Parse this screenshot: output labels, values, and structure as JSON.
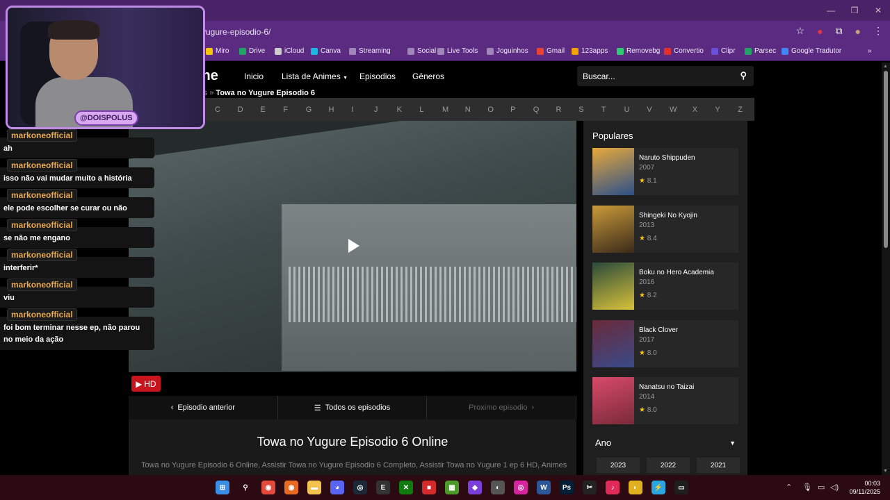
{
  "browser": {
    "url": "yugure-episodio-6/",
    "bookmarks": [
      {
        "label": "Miro",
        "color": "#f7c600"
      },
      {
        "label": "Drive",
        "color": "#1fa463"
      },
      {
        "label": "iCloud",
        "color": "#cccccc"
      },
      {
        "label": "Canva",
        "color": "#1db6e0"
      },
      {
        "label": "Streaming",
        "color": "#9e86b8"
      },
      {
        "label": "Social",
        "color": "#9e86b8"
      },
      {
        "label": "Live Tools",
        "color": "#9e86b8"
      },
      {
        "label": "Joguinhos",
        "color": "#9e86b8"
      },
      {
        "label": "Gmail",
        "color": "#ea4335"
      },
      {
        "label": "123apps",
        "color": "#f2a100"
      },
      {
        "label": "Removebg",
        "color": "#2ecc71"
      },
      {
        "label": "Convertio",
        "color": "#e5302a"
      },
      {
        "label": "Clipr",
        "color": "#6b4fd8"
      },
      {
        "label": "Parsec",
        "color": "#21a366"
      },
      {
        "label": "Google Tradutor",
        "color": "#4285f4"
      }
    ]
  },
  "site": {
    "logo_partial": "ine",
    "nav": [
      "Inicio",
      "Lista de Animes",
      "Episodios",
      "Gêneros"
    ],
    "search_placeholder": "Buscar...",
    "breadcrumb_prev": "dios »",
    "breadcrumb_current": "Towa no Yugure Episodio 6",
    "letters": [
      "C",
      "D",
      "E",
      "F",
      "G",
      "H",
      "I",
      "J",
      "K",
      "L",
      "M",
      "N",
      "O",
      "P",
      "Q",
      "R",
      "S",
      "T",
      "U",
      "V",
      "W",
      "X",
      "Y",
      "Z"
    ],
    "hd_label": "HD",
    "prev_episode": "Episodio anterior",
    "all_episodes": "Todos os episodios",
    "next_episode": "Proximo episodio",
    "episode_title": "Towa no Yugure Episodio 6 Online",
    "episode_desc": "Towa no Yugure Episodio 6 Online, Assistir Towa no Yugure Episodio 6 Completo, Assistir Towa no Yugure 1 ep 6 HD, Animes"
  },
  "sidebar": {
    "title": "Populares",
    "items": [
      {
        "name": "Naruto Shippuden",
        "year": "2007",
        "rating": "8.1",
        "color1": "#e8a93a",
        "color2": "#2b4f8a"
      },
      {
        "name": "Shingeki No Kyojin",
        "year": "2013",
        "rating": "8.4",
        "color1": "#c99a3a",
        "color2": "#3a2a1a"
      },
      {
        "name": "Boku no Hero Academia",
        "year": "2016",
        "rating": "8.2",
        "color1": "#2a4a3a",
        "color2": "#d8c23a"
      },
      {
        "name": "Black Clover",
        "year": "2017",
        "rating": "8.0",
        "color1": "#6a2a3a",
        "color2": "#3a4a8a"
      },
      {
        "name": "Nanatsu no Taizai",
        "year": "2014",
        "rating": "8.0",
        "color1": "#d84a6a",
        "color2": "#7a2a3a"
      }
    ],
    "year_label": "Ano",
    "years": [
      "2023",
      "2022",
      "2021"
    ]
  },
  "stream": {
    "handle": "@DOISPOLUS",
    "chat": [
      {
        "user": "markoneofficial",
        "text": "ah"
      },
      {
        "user": "markoneofficial",
        "text": "isso não vai mudar muito a história"
      },
      {
        "user": "markoneofficial",
        "text": "ele pode escolher se curar ou não"
      },
      {
        "user": "markoneofficial",
        "text": "se não me engano"
      },
      {
        "user": "markoneofficial",
        "text": "interferir*"
      },
      {
        "user": "markoneofficial",
        "text": "viu"
      },
      {
        "user": "markoneofficial",
        "text": "foi bom terminar nesse ep, não parou no meio da ação"
      }
    ]
  },
  "taskbar": {
    "time": "00:03",
    "date": "09/11/2025"
  }
}
